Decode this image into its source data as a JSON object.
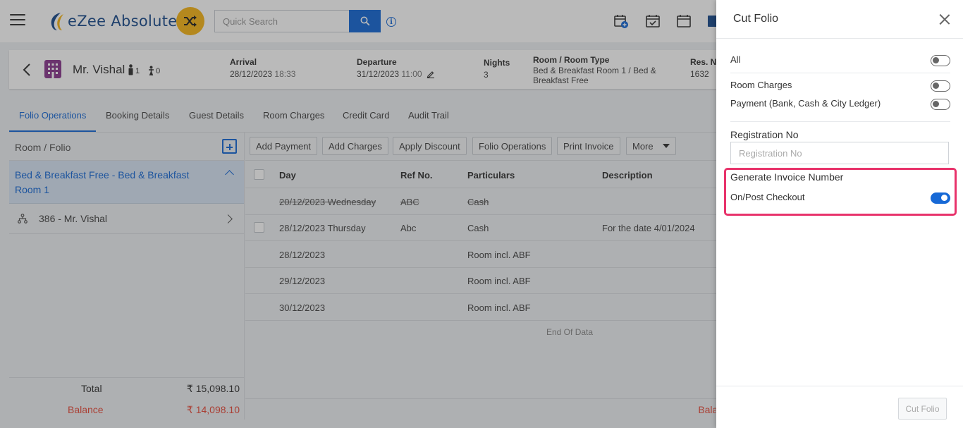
{
  "header": {
    "app_name": "eZee Absolute",
    "search_placeholder": "Quick Search"
  },
  "booking": {
    "guest_name": "Mr. Vishal",
    "adults": "1",
    "children": "0",
    "arrival_label": "Arrival",
    "arrival_date": "28/12/2023",
    "arrival_time": "18:33",
    "departure_label": "Departure",
    "departure_date": "31/12/2023",
    "departure_time": "11:00",
    "nights_label": "Nights",
    "nights": "3",
    "room_label": "Room / Room Type",
    "room_value": "Bed & Breakfast Room 1 / Bed & Breakfast Free",
    "resno_label": "Res. No",
    "resno_value": "1632"
  },
  "tabs": [
    {
      "label": "Folio Operations"
    },
    {
      "label": "Booking Details"
    },
    {
      "label": "Guest Details"
    },
    {
      "label": "Room Charges"
    },
    {
      "label": "Credit Card"
    },
    {
      "label": "Audit Trail"
    }
  ],
  "left_panel": {
    "title": "Room / Folio",
    "room_label": "Bed & Breakfast Free - Bed & Breakfast Room 1",
    "folio_label": "386 - Mr. Vishal",
    "total_label": "Total",
    "total_value": "₹ 15,098.10",
    "balance_label": "Balance",
    "balance_value": "₹ 14,098.10"
  },
  "toolbar": {
    "add_payment": "Add Payment",
    "add_charges": "Add Charges",
    "apply_discount": "Apply Discount",
    "folio_operations": "Folio Operations",
    "print_invoice": "Print Invoice",
    "more": "More"
  },
  "table": {
    "headers": {
      "day": "Day",
      "ref": "Ref No.",
      "particulars": "Particulars",
      "description": "Description"
    },
    "rows": [
      {
        "day": "20/12/2023 Wednesday",
        "ref": "ABC",
        "particulars": "Cash",
        "description": "",
        "voided": true
      },
      {
        "day": "28/12/2023 Thursday",
        "ref": "Abc",
        "particulars": "Cash",
        "description": "For the date 4/01/2024",
        "voided": false
      },
      {
        "day": "28/12/2023",
        "ref": "",
        "particulars": "Room incl. ABF",
        "description": "",
        "voided": false
      },
      {
        "day": "29/12/2023",
        "ref": "",
        "particulars": "Room incl. ABF",
        "description": "",
        "voided": false
      },
      {
        "day": "30/12/2023",
        "ref": "",
        "particulars": "Room incl. ABF",
        "description": "",
        "voided": false
      }
    ],
    "end_text": "End Of Data",
    "footer_balance": "Balar"
  },
  "drawer": {
    "title": "Cut Folio",
    "all_label": "All",
    "room_charges_label": "Room Charges",
    "payment_label": "Payment (Bank, Cash & City Ledger)",
    "registration_label": "Registration No",
    "registration_placeholder": "Registration No",
    "invoice_section_label": "Generate Invoice Number",
    "checkout_label": "On/Post Checkout",
    "cut_button": "Cut Folio"
  },
  "colors": {
    "accent": "#1769d6",
    "highlight": "#e8336b",
    "balance": "#e74c3c",
    "logo_badge": "#f6b51a"
  }
}
